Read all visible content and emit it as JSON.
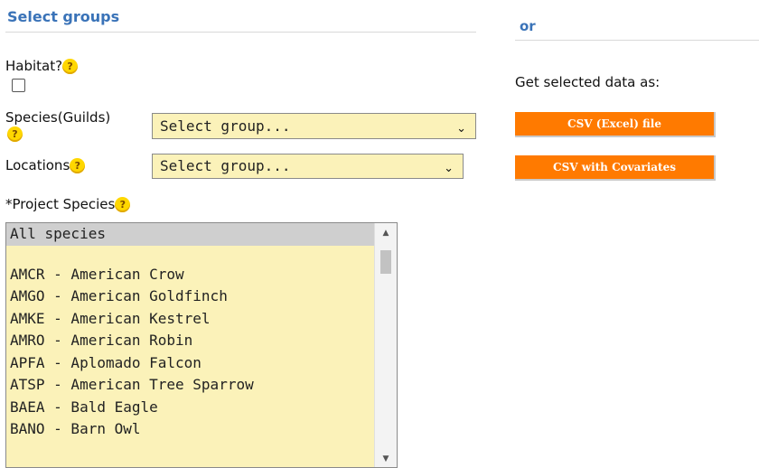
{
  "left": {
    "section_title": "Select groups",
    "habitat_label": "Habitat?",
    "species_guilds_label": "Species(Guilds)",
    "species_guilds_select": "Select group...",
    "locations_label": "Locations",
    "locations_select": "Select group...",
    "project_species_label": "*Project Species",
    "help_glyph": "?",
    "species_list": {
      "selected": "All species",
      "items": [
        "AMCR - American Crow",
        "AMGO - American Goldfinch",
        "AMKE - American Kestrel",
        "AMRO - American Robin",
        "APFA - Aplomado Falcon",
        "ATSP - American Tree Sparrow",
        "BAEA - Bald Eagle",
        "BANO - Barn Owl"
      ]
    }
  },
  "right": {
    "section_title": "or",
    "get_data_label": "Get selected data as:",
    "csv_button": "CSV (Excel) file",
    "csv_cov_button": "CSV with Covariates"
  }
}
